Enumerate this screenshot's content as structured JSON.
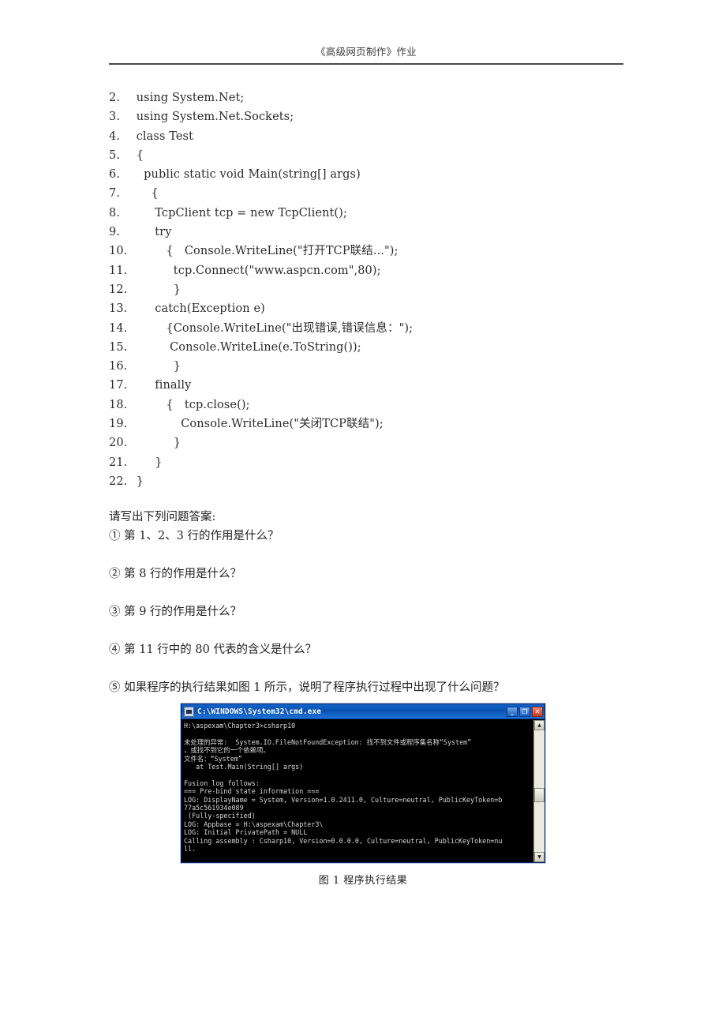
{
  "header": {
    "title": "《高级网页制作》作业"
  },
  "code": {
    "lines": [
      {
        "num": "2.",
        "text": "using System.Net;"
      },
      {
        "num": "3.",
        "text": "using System.Net.Sockets;"
      },
      {
        "num": "4.",
        "text": "class Test"
      },
      {
        "num": "5.",
        "text": "{"
      },
      {
        "num": "6.",
        "text": "  public static void Main(string[] args)"
      },
      {
        "num": "7.",
        "text": "    {"
      },
      {
        "num": "8.",
        "text": "     TcpClient tcp = new TcpClient();"
      },
      {
        "num": "9.",
        "text": "     try"
      },
      {
        "num": "10.",
        "text": "        {   Console.WriteLine(\"打开TCP联结...\");"
      },
      {
        "num": "11.",
        "text": "          tcp.Connect(\"www.aspcn.com\",80);"
      },
      {
        "num": "12.",
        "text": "          }"
      },
      {
        "num": "13.",
        "text": "     catch(Exception e)"
      },
      {
        "num": "14.",
        "text": "        {Console.WriteLine(\"出现错误,错误信息：\");"
      },
      {
        "num": "15.",
        "text": "         Console.WriteLine(e.ToString());"
      },
      {
        "num": "16.",
        "text": "          }"
      },
      {
        "num": "17.",
        "text": "     finally"
      },
      {
        "num": "18.",
        "text": "        {   tcp.close();"
      },
      {
        "num": "19.",
        "text": "            Console.WriteLine(\"关闭TCP联结\");"
      },
      {
        "num": "20.",
        "text": "          }"
      },
      {
        "num": "21.",
        "text": "     }"
      },
      {
        "num": "22.",
        "text": "}"
      }
    ]
  },
  "questions": {
    "intro": "请写出下列问题答案:",
    "items": [
      "① 第 1、2、3 行的作用是什么？",
      "② 第 8 行的作用是什么？",
      "③ 第 9 行的作用是什么？",
      "④ 第 11 行中的 80 代表的含义是什么？",
      "⑤ 如果程序的执行结果如图 1 所示，说明了程序执行过程中出现了什么问题？"
    ]
  },
  "figure": {
    "window": {
      "title": "C:\\WINDOWS\\System32\\cmd.exe",
      "icon": "console-window-icon",
      "minimize_label": "_",
      "maximize_label": "❐",
      "close_label": "✕",
      "titlebar_color": "#0a51b0",
      "background_color": "#000000",
      "text_color": "#d8d8d8"
    },
    "console_lines": [
      "H:\\aspexam\\Chapter3>csharp10",
      "",
      "未处理的异常:  System.IO.FileNotFoundException: 找不到文件或程序集名称“System”",
      "，或找不到它的一个依赖项。",
      "文件名：“System”",
      "   at Test.Main(String[] args)",
      "",
      "Fusion log follows:",
      "=== Pre-bind state information ===",
      "LOG: DisplayName = System, Version=1.0.2411.0, Culture=neutral, PublicKeyToken=b",
      "77a5c561934e089",
      " (Fully-specified)",
      "LOG: Appbase = H:\\aspexam\\Chapter3\\",
      "LOG: Initial PrivatePath = NULL",
      "Calling assembly : Csharp10, Version=0.0.0.0, Culture=neutral, PublicKeyToken=nu",
      "ll."
    ],
    "scrollbar": {
      "up_arrow": "▲",
      "down_arrow": "▼"
    },
    "caption": "图 1  程序执行结果"
  }
}
